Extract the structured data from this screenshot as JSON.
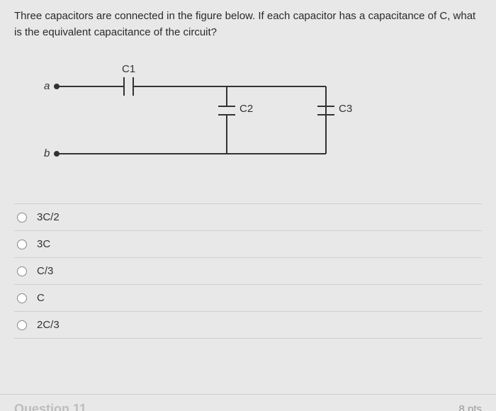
{
  "question": {
    "text": "Three capacitors are connected in the figure below. If each capacitor has a capacitance of C, what is the equivalent capacitance of the circuit?"
  },
  "circuit": {
    "node_a": "a",
    "node_b": "b",
    "c1_label": "C1",
    "c2_label": "C2",
    "c3_label": "C3"
  },
  "options": [
    {
      "label": "3C/2"
    },
    {
      "label": "3C"
    },
    {
      "label": "C/3"
    },
    {
      "label": "C"
    },
    {
      "label": "2C/3"
    }
  ],
  "footer": {
    "next_label": "Question 11",
    "points": "8 pts"
  }
}
